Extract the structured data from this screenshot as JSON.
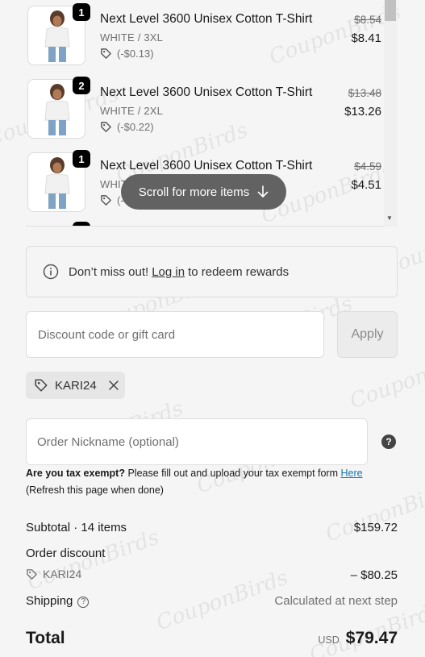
{
  "line_items": [
    {
      "title": "Next Level 3600 Unisex Cotton T-Shirt",
      "variant": "WHITE / 3XL",
      "discount": "(-$0.13)",
      "original_price": "$8.54",
      "price": "$8.41",
      "quantity": "1"
    },
    {
      "title": "Next Level 3600 Unisex Cotton T-Shirt",
      "variant": "WHITE / 2XL",
      "discount": "(-$0.22)",
      "original_price": "$13.48",
      "price": "$13.26",
      "quantity": "2"
    },
    {
      "title": "Next Level 3600 Unisex Cotton T-Shirt",
      "variant": "WHIT",
      "discount": "(-",
      "original_price": "$4.59",
      "price": "$4.51",
      "quantity": "1"
    }
  ],
  "scroll_hint": "Scroll for more items",
  "rewards_notice": {
    "before": "Don’t miss out!",
    "link": "Log in",
    "after": "to redeem rewards"
  },
  "discount_field": {
    "placeholder": "Discount code or gift card",
    "apply_label": "Apply"
  },
  "applied_code": "KARI24",
  "nickname_field": {
    "placeholder": "Order Nickname (optional)"
  },
  "tax": {
    "question": "Are you tax exempt?",
    "text": "Please fill out and upload your tax exempt form",
    "link": "Here",
    "note": "(Refresh this page when done)"
  },
  "summary": {
    "subtotal_label": "Subtotal · 14 items",
    "subtotal_value": "$159.72",
    "order_discount_label": "Order discount",
    "discount_code": "KARI24",
    "discount_value": "– $80.25",
    "shipping_label": "Shipping",
    "shipping_value": "Calculated at next step",
    "total_label": "Total",
    "currency": "USD",
    "total_value": "$79.47"
  },
  "watermark": "CouponBirds",
  "icons": [
    "tag-icon",
    "info-icon",
    "close-icon",
    "help-icon",
    "arrow-down-icon"
  ]
}
